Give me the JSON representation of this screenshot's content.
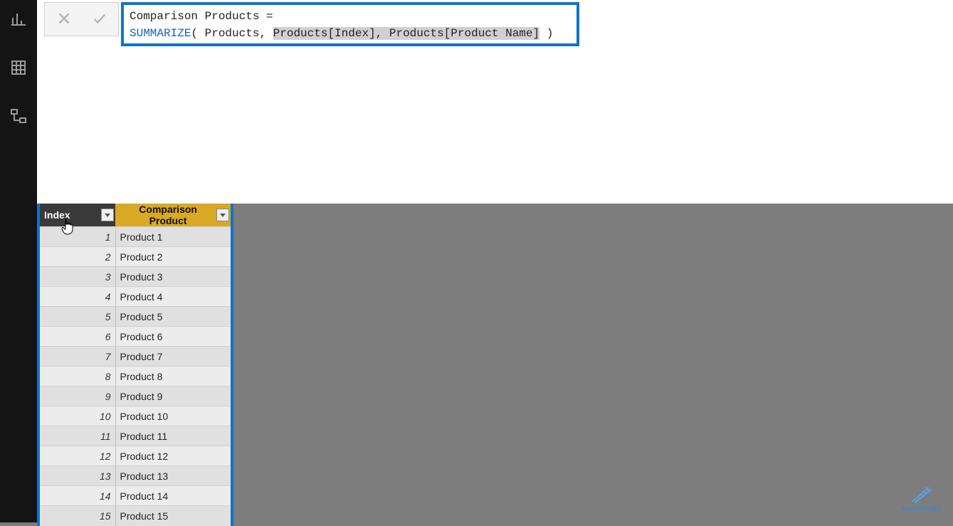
{
  "formula": {
    "line1_prefix": "Comparison Products = ",
    "line2_keyword": "SUMMARIZE",
    "line2_open": "( Products, ",
    "line2_selected": "Products[Index], Products[Product Name]",
    "line2_close": " )"
  },
  "columns": {
    "index": "Index",
    "product": "Comparison Product"
  },
  "rows": [
    {
      "index": "1",
      "product": "Product 1"
    },
    {
      "index": "2",
      "product": "Product 2"
    },
    {
      "index": "3",
      "product": "Product 3"
    },
    {
      "index": "4",
      "product": "Product 4"
    },
    {
      "index": "5",
      "product": "Product 5"
    },
    {
      "index": "6",
      "product": "Product 6"
    },
    {
      "index": "7",
      "product": "Product 7"
    },
    {
      "index": "8",
      "product": "Product 8"
    },
    {
      "index": "9",
      "product": "Product 9"
    },
    {
      "index": "10",
      "product": "Product 10"
    },
    {
      "index": "11",
      "product": "Product 11"
    },
    {
      "index": "12",
      "product": "Product 12"
    },
    {
      "index": "13",
      "product": "Product 13"
    },
    {
      "index": "14",
      "product": "Product 14"
    },
    {
      "index": "15",
      "product": "Product 15"
    }
  ],
  "badge": {
    "label": "SUBSCRIBE"
  }
}
